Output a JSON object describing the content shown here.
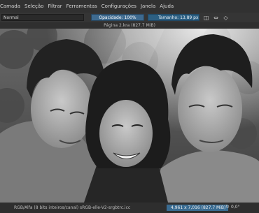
{
  "menubar": {
    "items": [
      "Janela",
      "Seleção",
      "Filtrar",
      "Ferramentas",
      "Configurações",
      "Janela",
      "Ajuda"
    ],
    "first": "Camada"
  },
  "toolbar": {
    "blend_mode": "Normal",
    "opacity": "Opacidade: 100%",
    "size": "Tamanho: 13.89 px"
  },
  "document": {
    "title": "Página 2.kra (827.7 MiB)"
  },
  "status": {
    "color_info": "RGB/Alfa (8 bits inteiros/canal)  sRGB-elle-V2-srgbtrc.icc",
    "dimensions": "4,961 x 7,016 (827.7 MiB)",
    "zoom": "0,0°"
  },
  "icons": [
    "chevron-down-icon",
    "brush-icon",
    "lock-icon",
    "zoom-icon"
  ]
}
